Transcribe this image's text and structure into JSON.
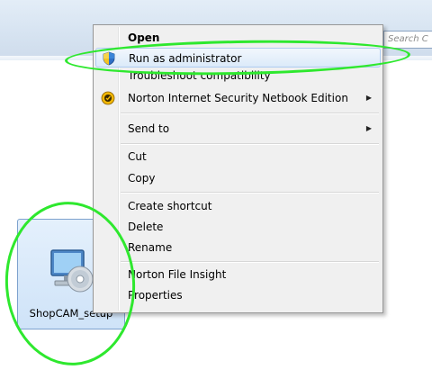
{
  "search": {
    "placeholder": "Search C"
  },
  "file": {
    "label": "ShopCAM_setup",
    "icon": "installer-cd-icon"
  },
  "menu": {
    "items": [
      {
        "label": "Open",
        "bold": true
      },
      {
        "label": "Run as administrator",
        "icon": "uac-shield-icon",
        "highlighted": true
      },
      {
        "label": "Troubleshoot compatibility"
      },
      {
        "label": "Norton Internet Security Netbook Edition",
        "icon": "norton-icon",
        "submenu": true
      },
      {
        "label": "Send to",
        "submenu": true
      },
      {
        "label": "Cut"
      },
      {
        "label": "Copy"
      },
      {
        "label": "Create shortcut"
      },
      {
        "label": "Delete"
      },
      {
        "label": "Rename"
      },
      {
        "label": "Norton File Insight"
      },
      {
        "label": "Properties"
      }
    ]
  },
  "colors": {
    "annotation": "#2ee82e",
    "highlight": "#dbeaf9",
    "menu_bg": "#f0f0f0"
  }
}
